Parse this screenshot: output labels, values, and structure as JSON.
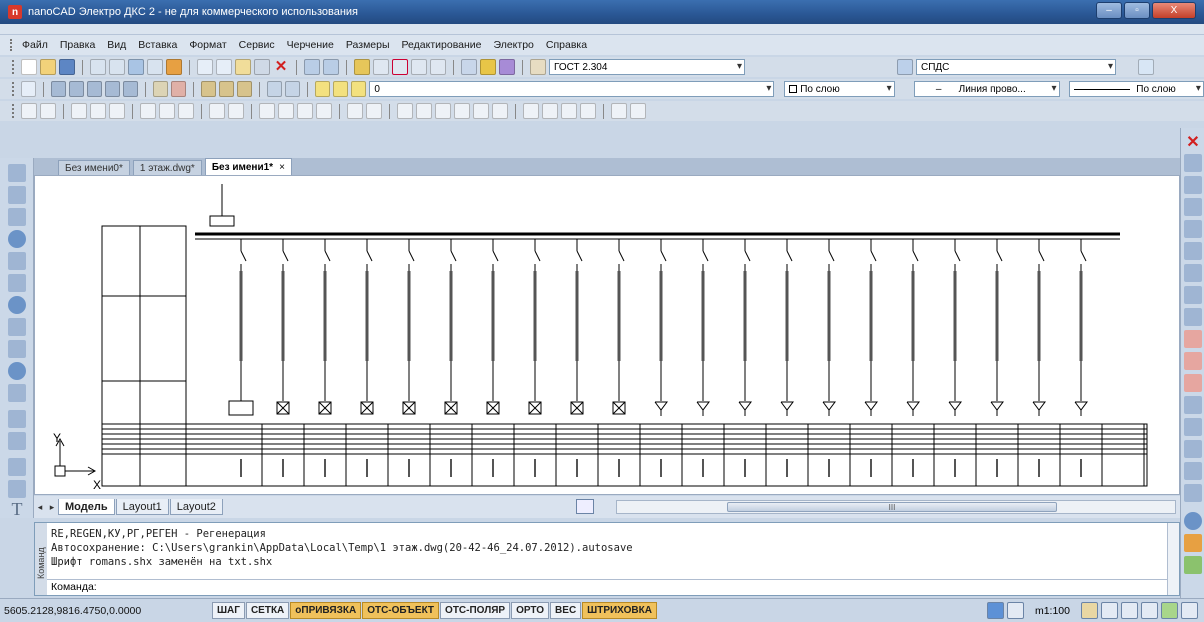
{
  "window": {
    "title": "nanoCAD Электро ДКС 2 - не для коммерческого использования",
    "app_icon_letter": "n",
    "min_label": "–",
    "max_label": "▫",
    "close_label": "X"
  },
  "menu": [
    "Файл",
    "Правка",
    "Вид",
    "Вставка",
    "Формат",
    "Сервис",
    "Черчение",
    "Размеры",
    "Редактирование",
    "Электро",
    "Справка"
  ],
  "toolbar": {
    "text_style": "ГОСТ 2.304",
    "dim_style": "СПДС",
    "layer": "0",
    "color": "По слою",
    "linetype": "Линия прово...",
    "lineweight": "По слою",
    "lineweight_dash": "–"
  },
  "doc_tabs": [
    {
      "label": "Без имени0*",
      "active": false
    },
    {
      "label": "1 этаж.dwg*",
      "active": false
    },
    {
      "label": "Без имени1*",
      "active": true
    }
  ],
  "close_glyph": "×",
  "layout_tabs": [
    {
      "label": "Модель",
      "active": true
    },
    {
      "label": "Layout1",
      "active": false
    },
    {
      "label": "Layout2",
      "active": false
    }
  ],
  "layout_nav": {
    "prev": "◂",
    "next": "▸"
  },
  "hscroll_mark": "III",
  "axis": {
    "y": "Y",
    "x": "X"
  },
  "command": {
    "side_label": "Команд",
    "lines": [
      "RE,REGEN,КУ,РГ,РЕГЕН - Регенерация",
      "Автосохранение: C:\\Users\\grankin\\AppData\\Local\\Temp\\1 этаж.dwg(20-42-46_24.07.2012).autosave",
      "Шрифт romans.shx заменён на txt.shx"
    ],
    "prompt": "Команда:"
  },
  "status": {
    "coords": "5605.2128,9816.4750,0.0000",
    "buttons": [
      {
        "label": "ШАГ",
        "on": false
      },
      {
        "label": "СЕТКА",
        "on": false
      },
      {
        "label": "оПРИВЯЗКА",
        "on": true
      },
      {
        "label": "ОТС-ОБЪЕКТ",
        "on": true
      },
      {
        "label": "ОТС-ПОЛЯР",
        "on": false
      },
      {
        "label": "ОРТО",
        "on": false
      },
      {
        "label": "ВЕС",
        "on": false
      },
      {
        "label": "ШТРИХОВКА",
        "on": true
      }
    ],
    "scale": "m1:100"
  },
  "colors": {
    "accent": "#2a5794",
    "status_on": "#f0c15b",
    "close": "#c4402a"
  }
}
